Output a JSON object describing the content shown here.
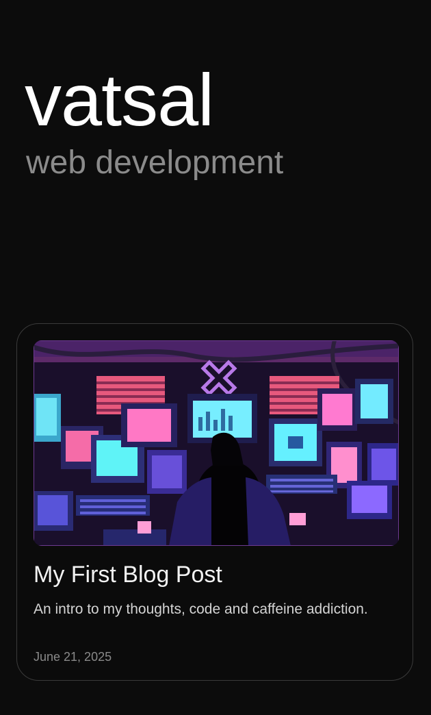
{
  "header": {
    "title": "vatsal",
    "subtitle": "web development"
  },
  "posts": [
    {
      "title": "My First Blog Post",
      "excerpt": "An intro to my thoughts, code and caffeine addiction.",
      "date": "June 21, 2025",
      "image": "pixel-art-hacker-monitors-illustration"
    }
  ],
  "colors": {
    "background": "#0c0c0c",
    "title": "#ffffff",
    "subtitle": "#8b8b8b",
    "card_border": "#3b3b3b"
  }
}
